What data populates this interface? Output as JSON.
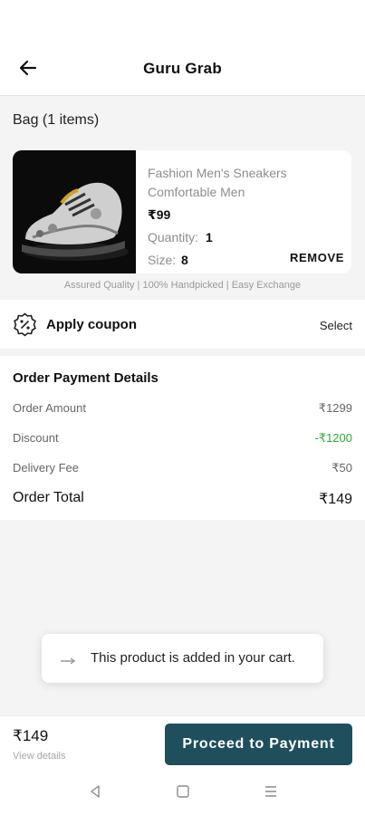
{
  "header": {
    "title": "Guru Grab",
    "back_icon": "arrow-left-icon"
  },
  "bag": {
    "title": "Bag (1 items)"
  },
  "cart_item": {
    "name": "Fashion Men's Sneakers Comfortable Men",
    "price": "₹99",
    "quantity_label": "Quantity:",
    "quantity_value": "1",
    "size_label": "Size:",
    "size_value": "8",
    "remove_label": "REMOVE",
    "image_icon": "sneaker-image"
  },
  "assurance": "Assured Quality  |  100% Handpicked  |  Easy Exchange",
  "coupon": {
    "label": "Apply coupon",
    "action": "Select",
    "icon": "percent-badge-icon"
  },
  "payment": {
    "title": "Order Payment Details",
    "rows": [
      {
        "label": "Order Amount",
        "value": "₹1299"
      },
      {
        "label": "Discount",
        "value": "-₹1200"
      },
      {
        "label": "Delivery Fee",
        "value": "₹50"
      }
    ],
    "total_label": "Order Total",
    "total_value": "₹149"
  },
  "toast": {
    "message": "This product is added in your cart."
  },
  "footer": {
    "price": "₹149",
    "view_details": "View details",
    "cta": "Proceed to Payment"
  },
  "system_nav": {
    "back": "nav-back-icon",
    "home": "nav-home-icon",
    "menu": "nav-menu-icon"
  },
  "colors": {
    "accent": "#1f4f5c",
    "discount": "#2faa3a",
    "background": "#f4f4f4"
  }
}
